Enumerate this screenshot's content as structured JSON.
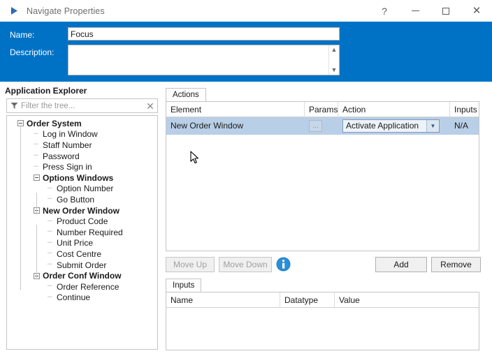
{
  "window": {
    "title": "Navigate Properties",
    "icon": "navigate-arrow-icon",
    "controls": {
      "help": "?",
      "minimize": "minimize-icon",
      "maximize": "maximize-icon",
      "close": "close-icon"
    },
    "header_color": "#0072c6"
  },
  "header": {
    "name_label": "Name:",
    "name_value": "Focus",
    "description_label": "Description:",
    "description_value": "",
    "scroll_up": "⌃",
    "scroll_down": "⌄"
  },
  "explorer": {
    "title": "Application Explorer",
    "filter_placeholder": "Filter the tree...",
    "filter_value": "",
    "filter_icon": "funnel-icon",
    "clear_icon": "✕",
    "tree": [
      {
        "label": "Order System",
        "level": 0,
        "bold": true,
        "expandable": true
      },
      {
        "label": "Log in Window",
        "level": 1,
        "bold": false,
        "expandable": false
      },
      {
        "label": "Staff Number",
        "level": 1,
        "bold": false,
        "expandable": false
      },
      {
        "label": "Password",
        "level": 1,
        "bold": false,
        "expandable": false
      },
      {
        "label": "Press Sign in",
        "level": 1,
        "bold": false,
        "expandable": false
      },
      {
        "label": "Options Windows",
        "level": 1,
        "bold": true,
        "expandable": true
      },
      {
        "label": "Option Number",
        "level": 2,
        "bold": false,
        "expandable": false
      },
      {
        "label": "Go Button",
        "level": 2,
        "bold": false,
        "expandable": false
      },
      {
        "label": "New Order Window",
        "level": 1,
        "bold": true,
        "expandable": true
      },
      {
        "label": "Product Code",
        "level": 2,
        "bold": false,
        "expandable": false
      },
      {
        "label": "Number Required",
        "level": 2,
        "bold": false,
        "expandable": false
      },
      {
        "label": "Unit Price",
        "level": 2,
        "bold": false,
        "expandable": false
      },
      {
        "label": "Cost Centre",
        "level": 2,
        "bold": false,
        "expandable": false
      },
      {
        "label": "Submit Order",
        "level": 2,
        "bold": false,
        "expandable": false
      },
      {
        "label": "Order Conf Window",
        "level": 1,
        "bold": true,
        "expandable": true
      },
      {
        "label": "Order Reference",
        "level": 2,
        "bold": false,
        "expandable": false
      },
      {
        "label": "Continue",
        "level": 2,
        "bold": false,
        "expandable": false
      }
    ]
  },
  "actions": {
    "tab_label": "Actions",
    "columns": [
      "Element",
      "Params",
      "Action",
      "Inputs S.."
    ],
    "rows": [
      {
        "element": "New Order Window",
        "params": "...",
        "action": "Activate Application",
        "inputs_supplied": "N/A",
        "selected": true
      }
    ],
    "selected_row_color": "#b9cfe7"
  },
  "toolbar": {
    "move_up": "Move Up",
    "move_down": "Move Down",
    "info_icon": "info-icon",
    "add": "Add",
    "remove": "Remove"
  },
  "inputs": {
    "tab_label": "Inputs",
    "columns": [
      "Name",
      "Datatype",
      "Value"
    ],
    "rows": []
  }
}
